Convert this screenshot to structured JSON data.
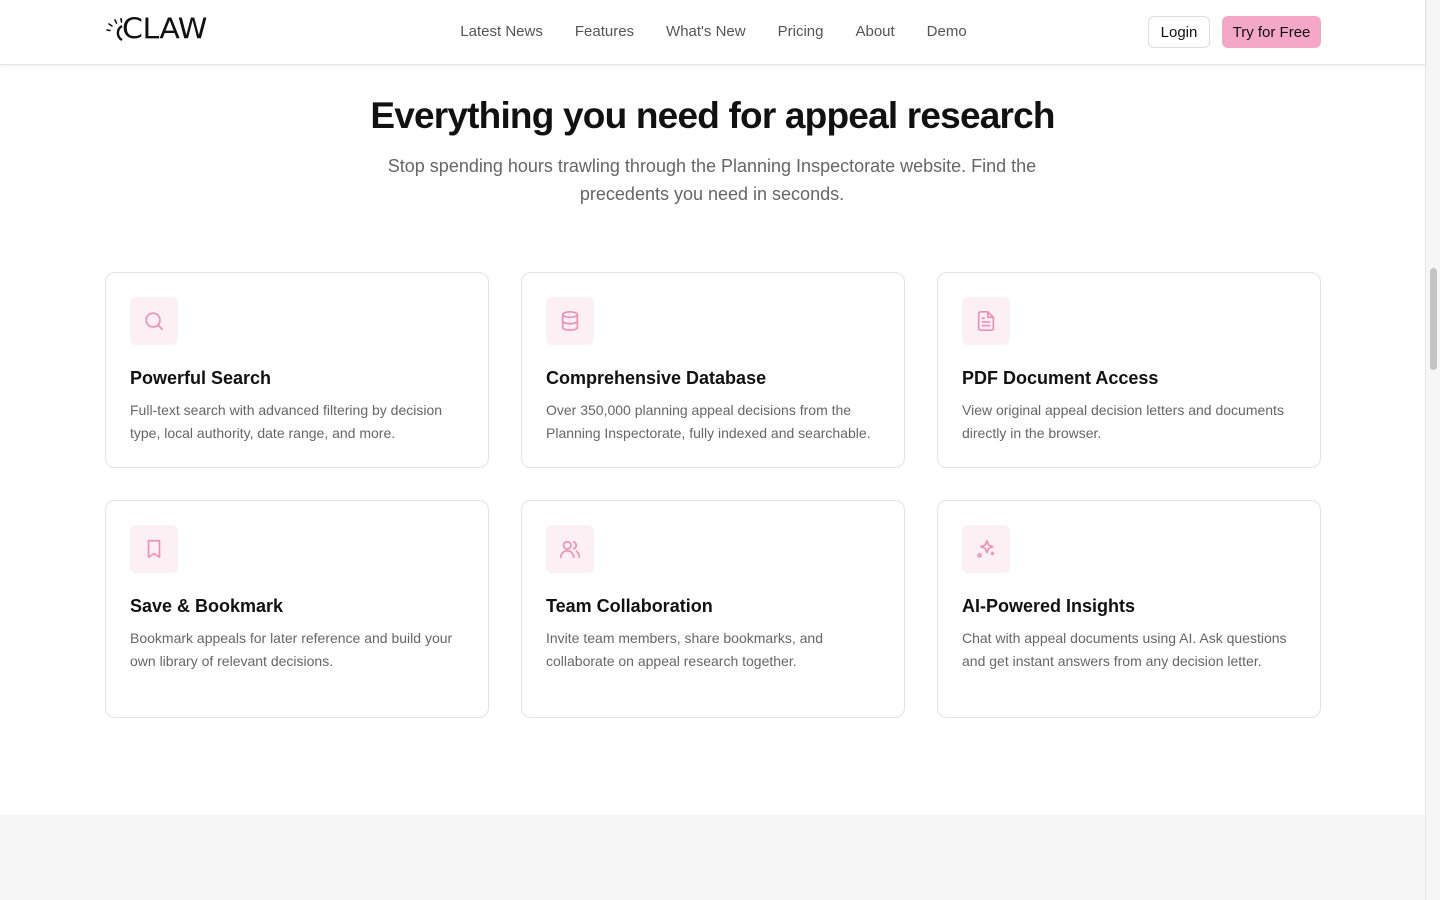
{
  "brand": {
    "name": "CLAW",
    "accent": "#f4a7c6"
  },
  "nav": {
    "items": [
      {
        "label": "Latest News"
      },
      {
        "label": "Features"
      },
      {
        "label": "What's New"
      },
      {
        "label": "Pricing"
      },
      {
        "label": "About"
      },
      {
        "label": "Demo"
      }
    ],
    "login_label": "Login",
    "try_label": "Try for Free"
  },
  "hero": {
    "title": "Everything you need for appeal research",
    "subtitle": "Stop spending hours trawling through the Planning Inspectorate website. Find the precedents you need in seconds."
  },
  "features": [
    {
      "icon": "search-icon",
      "title": "Powerful Search",
      "desc": "Full-text search with advanced filtering by decision type, local authority, date range, and more."
    },
    {
      "icon": "database-icon",
      "title": "Comprehensive Database",
      "desc": "Over 350,000 planning appeal decisions from the Planning Inspectorate, fully indexed and searchable."
    },
    {
      "icon": "document-icon",
      "title": "PDF Document Access",
      "desc": "View original appeal decision letters and documents directly in the browser."
    },
    {
      "icon": "bookmark-icon",
      "title": "Save & Bookmark",
      "desc": "Bookmark appeals for later reference and build your own library of relevant decisions."
    },
    {
      "icon": "users-icon",
      "title": "Team Collaboration",
      "desc": "Invite team members, share bookmarks, and collaborate on appeal research together."
    },
    {
      "icon": "sparkles-icon",
      "title": "AI-Powered Insights",
      "desc": "Chat with appeal documents using AI. Ask questions and get instant answers from any decision letter."
    }
  ]
}
